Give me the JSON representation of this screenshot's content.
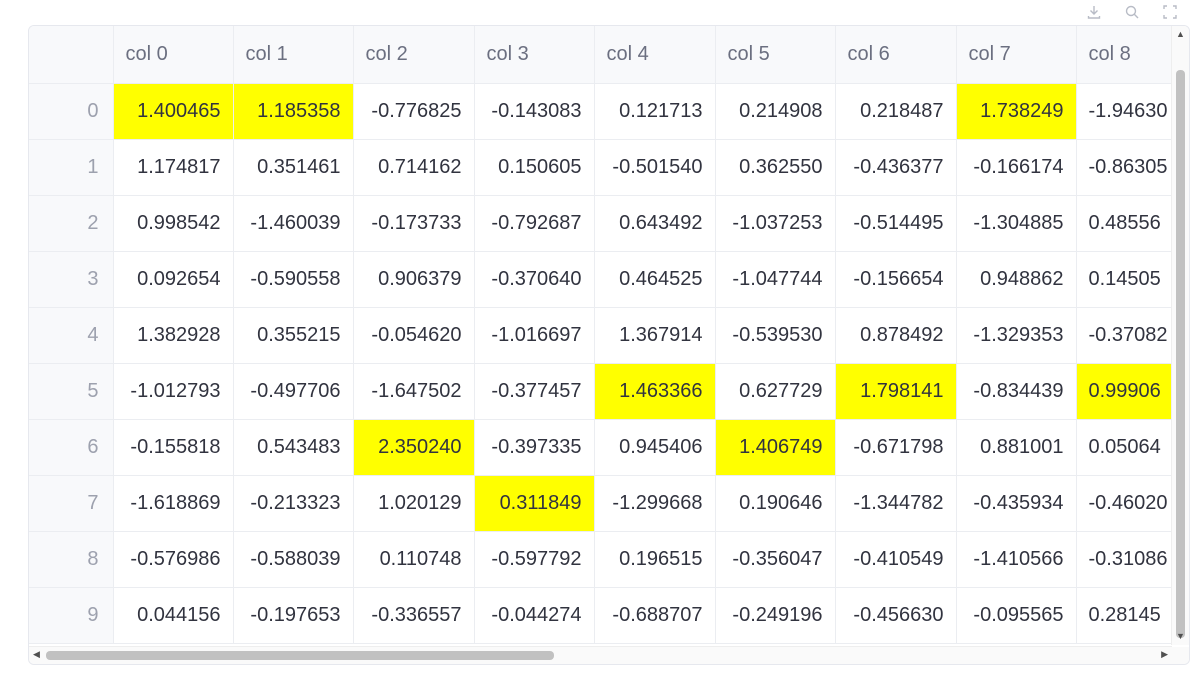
{
  "toolbar": {
    "icons": [
      "download-icon",
      "search-icon",
      "fullscreen-icon"
    ]
  },
  "table": {
    "columns": [
      "col 0",
      "col 1",
      "col 2",
      "col 3",
      "col 4",
      "col 5",
      "col 6",
      "col 7",
      "col 8"
    ],
    "rows": [
      {
        "index": "0",
        "cells": [
          "1.400465",
          "1.185358",
          "-0.776825",
          "-0.143083",
          "0.121713",
          "0.214908",
          "0.218487",
          "1.738249",
          "-1.94630"
        ],
        "highlight": [
          0,
          1,
          7
        ]
      },
      {
        "index": "1",
        "cells": [
          "1.174817",
          "0.351461",
          "0.714162",
          "0.150605",
          "-0.501540",
          "0.362550",
          "-0.436377",
          "-0.166174",
          "-0.86305"
        ],
        "highlight": []
      },
      {
        "index": "2",
        "cells": [
          "0.998542",
          "-1.460039",
          "-0.173733",
          "-0.792687",
          "0.643492",
          "-1.037253",
          "-0.514495",
          "-1.304885",
          "0.48556"
        ],
        "highlight": []
      },
      {
        "index": "3",
        "cells": [
          "0.092654",
          "-0.590558",
          "0.906379",
          "-0.370640",
          "0.464525",
          "-1.047744",
          "-0.156654",
          "0.948862",
          "0.14505"
        ],
        "highlight": []
      },
      {
        "index": "4",
        "cells": [
          "1.382928",
          "0.355215",
          "-0.054620",
          "-1.016697",
          "1.367914",
          "-0.539530",
          "0.878492",
          "-1.329353",
          "-0.37082"
        ],
        "highlight": []
      },
      {
        "index": "5",
        "cells": [
          "-1.012793",
          "-0.497706",
          "-1.647502",
          "-0.377457",
          "1.463366",
          "0.627729",
          "1.798141",
          "-0.834439",
          "0.99906"
        ],
        "highlight": [
          4,
          6,
          8
        ]
      },
      {
        "index": "6",
        "cells": [
          "-0.155818",
          "0.543483",
          "2.350240",
          "-0.397335",
          "0.945406",
          "1.406749",
          "-0.671798",
          "0.881001",
          "0.05064"
        ],
        "highlight": [
          2,
          5
        ]
      },
      {
        "index": "7",
        "cells": [
          "-1.618869",
          "-0.213323",
          "1.020129",
          "0.311849",
          "-1.299668",
          "0.190646",
          "-1.344782",
          "-0.435934",
          "-0.46020"
        ],
        "highlight": [
          3
        ]
      },
      {
        "index": "8",
        "cells": [
          "-0.576986",
          "-0.588039",
          "0.110748",
          "-0.597792",
          "0.196515",
          "-0.356047",
          "-0.410549",
          "-1.410566",
          "-0.31086"
        ],
        "highlight": []
      },
      {
        "index": "9",
        "cells": [
          "0.044156",
          "-0.197653",
          "-0.336557",
          "-0.044274",
          "-0.688707",
          "-0.249196",
          "-0.456630",
          "-0.095565",
          "0.28145"
        ],
        "highlight": []
      }
    ]
  },
  "colors": {
    "highlight": "#ffff00",
    "header_bg": "#f8f9fb",
    "grid_line": "#ebedf1"
  }
}
